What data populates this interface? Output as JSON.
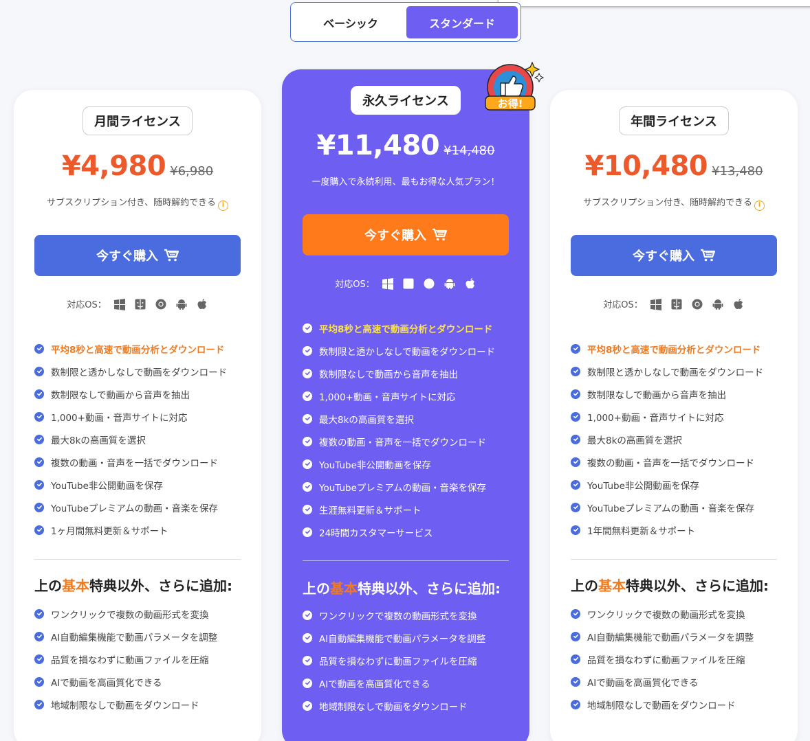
{
  "toggle": {
    "basic": "ベーシック",
    "standard": "スタンダード",
    "active": "standard"
  },
  "colors": {
    "accent_purple": "#6e5ff2",
    "buy_blue": "#4a6cdf",
    "buy_orange": "#ff7a1a",
    "price_orange": "#ec5a2b",
    "highlight": "#f27a1e",
    "highlight_yellow": "#ffe43a"
  },
  "plans": {
    "monthly": {
      "name": "月間ライセンス",
      "price": "¥4,980",
      "old_price": "¥6,980",
      "note": "サブスクリプション付き、随時解約できる",
      "buy": "今すぐ購入",
      "os_label": "対応OS：",
      "features": [
        "平均8秒と高速で動画分析とダウンロード",
        "数制限と透かしなしで動画をダウンロード",
        "数制限なしで動画から音声を抽出",
        "1,000+動画・音声サイトに対応",
        "最大8kの高画質を選択",
        "複数の動画・音声を一括でダウンロード",
        "YouTube非公開動画を保存",
        "YouTubeプレミアムの動画・音楽を保存",
        "1ヶ月間無料更新＆サポート"
      ]
    },
    "permanent": {
      "name": "永久ライセンス",
      "price": "¥11,480",
      "old_price": "¥14,480",
      "note": "一度購入で永続利用、最もお得な人気プラン！",
      "buy": "今すぐ購入",
      "os_label": "対応OS：",
      "badge": "お得!",
      "features": [
        "平均8秒と高速で動画分析とダウンロード",
        "数制限と透かしなしで動画をダウンロード",
        "数制限なしで動画から音声を抽出",
        "1,000+動画・音声サイトに対応",
        "最大8kの高画質を選択",
        "複数の動画・音声を一括でダウンロード",
        "YouTube非公開動画を保存",
        "YouTubeプレミアムの動画・音楽を保存",
        "生涯無料更新＆サポート",
        "24時間カスタマーサービス"
      ]
    },
    "yearly": {
      "name": "年間ライセンス",
      "price": "¥10,480",
      "old_price": "¥13,480",
      "note": "サブスクリプション付き、随時解約できる",
      "buy": "今すぐ購入",
      "os_label": "対応OS：",
      "features": [
        "平均8秒と高速で動画分析とダウンロード",
        "数制限と透かしなしで動画をダウンロード",
        "数制限なしで動画から音声を抽出",
        "1,000+動画・音声サイトに対応",
        "最大8kの高画質を選択",
        "複数の動画・音声を一括でダウンロード",
        "YouTube非公開動画を保存",
        "YouTubeプレミアムの動画・音楽を保存",
        "1年間無料更新＆サポート"
      ]
    }
  },
  "extras": {
    "title_pre": "上の",
    "title_accent": "基本",
    "title_post": "特典以外、さらに追加:",
    "items": [
      "ワンクリックで複数の動画形式を変換",
      "AI自動編集機能で動画パラメータを調整",
      "品質を損なわずに動画ファイルを圧縮",
      "AIで動画を高画質化できる",
      "地域制限なしで動画をダウンロード"
    ]
  },
  "os_icons": [
    "windows-icon",
    "mac-finder-icon",
    "chrome-icon",
    "android-icon",
    "apple-icon"
  ]
}
